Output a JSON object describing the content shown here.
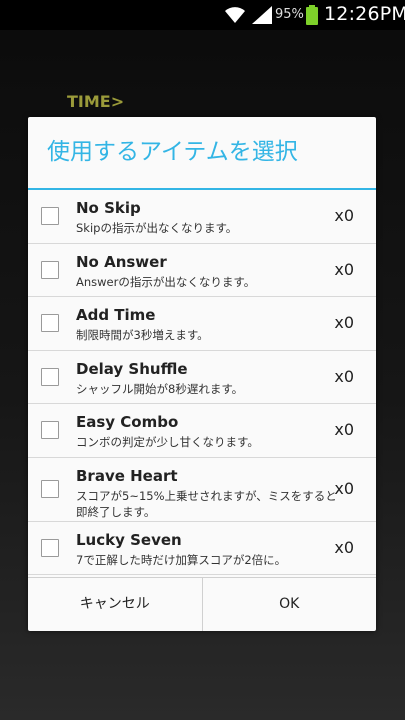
{
  "status_bar": {
    "battery_percent": "95%",
    "time": "12:26PM",
    "battery_color": "#7ed12a"
  },
  "background": {
    "label": "TIME>"
  },
  "dialog": {
    "title": "使用するアイテムを選択",
    "accent_color": "#33b5e5",
    "items": [
      {
        "name": "No Skip",
        "description": "Skipの指示が出なくなります。",
        "count": "x0"
      },
      {
        "name": "No Answer",
        "description": "Answerの指示が出なくなります。",
        "count": "x0"
      },
      {
        "name": "Add Time",
        "description": "制限時間が3秒増えます。",
        "count": "x0"
      },
      {
        "name": "Delay Shuffle",
        "description": "シャッフル開始が8秒遅れます。",
        "count": "x0"
      },
      {
        "name": "Easy Combo",
        "description": "コンボの判定が少し甘くなります。",
        "count": "x0"
      },
      {
        "name": "Brave Heart",
        "description": "スコアが5~15%上乗せされますが、ミスをすると即終了します。",
        "count": "x0"
      },
      {
        "name": "Lucky Seven",
        "description": "7で正解した時だけ加算スコアが2倍に。",
        "count": "x0"
      }
    ],
    "cancel_label": "キャンセル",
    "ok_label": "OK"
  }
}
